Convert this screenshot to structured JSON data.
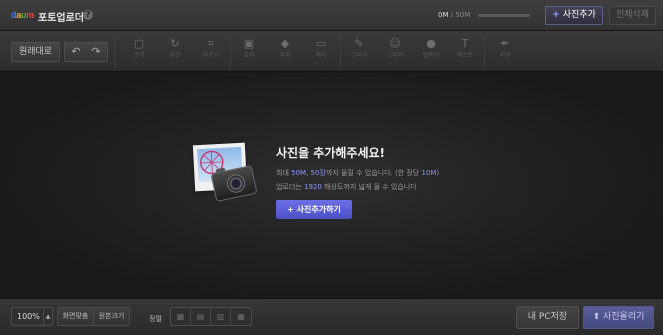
{
  "header": {
    "logo": {
      "d": "d",
      "a": "a",
      "u": "u",
      "m": "m"
    },
    "title": "포토업로더",
    "help_label": "?",
    "capacity_used": "0M",
    "capacity_total": " / 50M",
    "capacity_fraction": 0,
    "add_photo_label": "사진추가",
    "delete_all_label": "전체삭제"
  },
  "toolbar": {
    "reset_label": "원래대로",
    "undo_label": "↶",
    "redo_label": "↷",
    "tools": [
      {
        "label": "크기",
        "icon": "▢"
      },
      {
        "label": "회전",
        "icon": "↻"
      },
      {
        "label": "자르기",
        "icon": "⌗"
      },
      {
        "label": "효과",
        "icon": "▣"
      },
      {
        "label": "수정",
        "icon": "◆"
      },
      {
        "label": "액자",
        "icon": "▭"
      },
      {
        "label": "그리기",
        "icon": "✎"
      },
      {
        "label": "스티커",
        "icon": "☺"
      },
      {
        "label": "말풍선",
        "icon": "●"
      },
      {
        "label": "텍스트",
        "icon": "T"
      },
      {
        "label": "서명",
        "icon": "✒"
      }
    ]
  },
  "main": {
    "headline": "사진을 추가해주세요!",
    "line1": {
      "p1": "최대 ",
      "size": "50M",
      "p2": ", ",
      "count": "50장",
      "p3": "까지 올릴 수 있습니다. (한 장당 ",
      "per": "10M",
      "p4": ")"
    },
    "line2": {
      "p1": "업로더는 ",
      "res": "1920",
      "p2": " 해상도까지 넓게 올 수 있습니다"
    },
    "cta_label": "사진추가하기",
    "cta_icon": "+"
  },
  "footer": {
    "zoom_value": "100%",
    "fit_label": "화면맞춤",
    "original_label": "원본크기",
    "sort_label": "정렬",
    "save_pc_label": "내 PC저장",
    "upload_label": "사진올리기",
    "upload_icon": "⬆"
  },
  "colors": {
    "accent": "#8f95ff",
    "cta": "#5a5fd6",
    "background": "#1a1a1a"
  }
}
